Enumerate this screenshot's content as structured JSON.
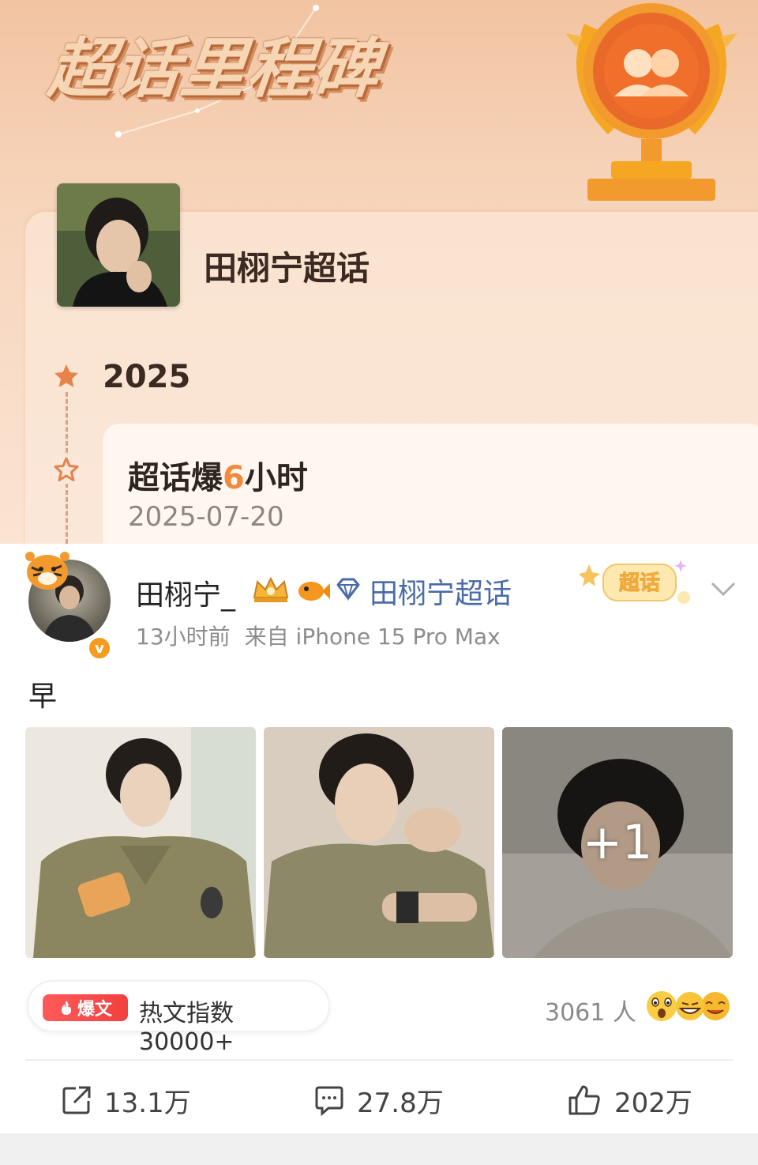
{
  "milestone": {
    "title": "超话里程碑",
    "topic_name": "田栩宁超话",
    "year": "2025",
    "event": {
      "title_prefix": "超话爆",
      "title_highlight": "6",
      "title_suffix": "小时",
      "date": "2025-07-20"
    }
  },
  "post": {
    "username": "田栩宁_",
    "topic_link": "田栩宁超话",
    "sticker_text": "超话",
    "time": "13小时前",
    "source": "来自 iPhone 15 Pro Max",
    "text": "早",
    "more_images": "+1",
    "hot": {
      "tag": "爆文",
      "text": "热文指数30000+"
    },
    "reactors": "3061 人",
    "actions": {
      "repost": "13.1万",
      "comment": "27.8万",
      "like": "202万"
    }
  },
  "colors": {
    "accent_orange": "#f08a3c",
    "link_blue": "#4a6aa8",
    "hot_red": "#f2403e"
  }
}
